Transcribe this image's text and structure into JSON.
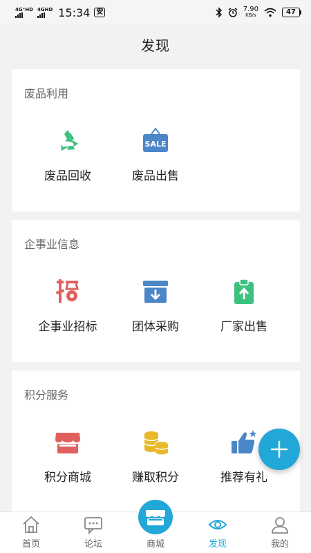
{
  "status_bar": {
    "sim1": "4G⁺HD",
    "sim2": "4GHD",
    "time": "15:34",
    "badge": "安",
    "speed_value": "7.90",
    "speed_unit": "KB/s",
    "battery": "47"
  },
  "header": {
    "title": "发现"
  },
  "sections": [
    {
      "title": "废品利用",
      "items": [
        {
          "label": "废品回收",
          "icon": "recycle-icon"
        },
        {
          "label": "废品出售",
          "icon": "sale-sign-icon"
        }
      ]
    },
    {
      "title": "企事业信息",
      "items": [
        {
          "label": "企事业招标",
          "icon": "tender-icon"
        },
        {
          "label": "团体采购",
          "icon": "download-box-icon"
        },
        {
          "label": "厂家出售",
          "icon": "clipboard-upload-icon"
        }
      ]
    },
    {
      "title": "积分服务",
      "items": [
        {
          "label": "积分商城",
          "icon": "storefront-icon"
        },
        {
          "label": "赚取积分",
          "icon": "coins-icon"
        },
        {
          "label": "推荐有礼",
          "icon": "thumbs-up-icon"
        }
      ]
    }
  ],
  "fab": {
    "icon": "plus-icon"
  },
  "bottom_nav": [
    {
      "label": "首页",
      "icon": "home-icon",
      "active": false
    },
    {
      "label": "论坛",
      "icon": "chat-icon",
      "active": false
    },
    {
      "label": "商城",
      "icon": "store-icon",
      "active": false
    },
    {
      "label": "发现",
      "icon": "eye-icon",
      "active": true
    },
    {
      "label": "我的",
      "icon": "user-icon",
      "active": false
    }
  ],
  "colors": {
    "accent": "#22a7d9",
    "recycle": "#3dc17f",
    "sale": "#4a86c8",
    "tender": "#e0605e",
    "box": "#4a86c8",
    "clipboard": "#3dc17f",
    "store": "#e0605e",
    "coins": "#e8b92c",
    "thumb": "#4a86c8"
  }
}
